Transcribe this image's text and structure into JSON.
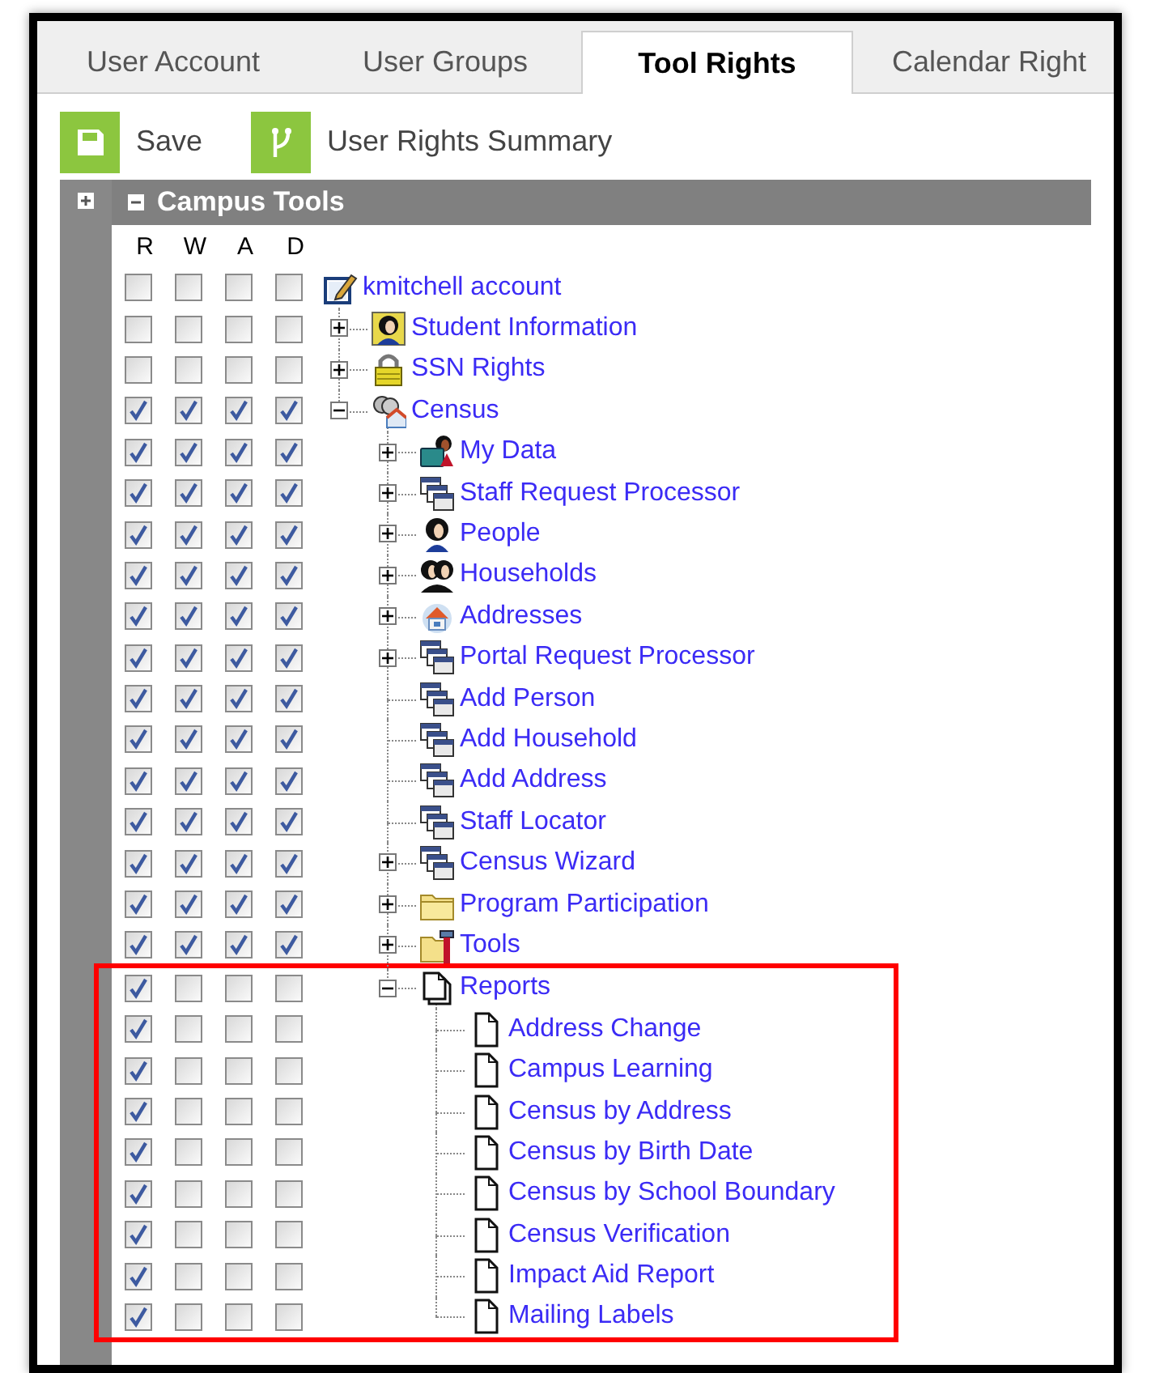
{
  "tabs": [
    {
      "label": "User Account",
      "selected": false
    },
    {
      "label": "User Groups",
      "selected": false
    },
    {
      "label": "Tool Rights",
      "selected": true
    },
    {
      "label": "Calendar Right",
      "selected": false
    }
  ],
  "toolbar": [
    {
      "label": "Save",
      "kind": "save"
    },
    {
      "label": "User Rights Summary",
      "kind": "summary"
    }
  ],
  "panel": {
    "title": "Campus Tools",
    "expanded": true,
    "columns": [
      "R",
      "W",
      "A",
      "D"
    ]
  },
  "tree": [
    {
      "label": "kmitchell account",
      "kind": "edit",
      "rights": [
        false,
        false,
        false,
        false
      ],
      "children": [
        {
          "label": "Student Information",
          "kind": "student",
          "expanded": false,
          "rights": [
            false,
            false,
            false,
            false
          ]
        },
        {
          "label": "SSN Rights",
          "kind": "lock",
          "expanded": false,
          "rights": [
            false,
            false,
            false,
            false
          ]
        },
        {
          "label": "Census",
          "kind": "census",
          "expanded": true,
          "rights": [
            true,
            true,
            true,
            true
          ],
          "children": [
            {
              "label": "My Data",
              "kind": "mydata",
              "expanded": false,
              "rights": [
                true,
                true,
                true,
                true
              ]
            },
            {
              "label": "Staff Request Processor",
              "kind": "windows",
              "expanded": false,
              "rights": [
                true,
                true,
                true,
                true
              ]
            },
            {
              "label": "People",
              "kind": "person",
              "expanded": false,
              "rights": [
                true,
                true,
                true,
                true
              ]
            },
            {
              "label": "Households",
              "kind": "people",
              "expanded": false,
              "rights": [
                true,
                true,
                true,
                true
              ]
            },
            {
              "label": "Addresses",
              "kind": "house",
              "expanded": false,
              "rights": [
                true,
                true,
                true,
                true
              ]
            },
            {
              "label": "Portal Request Processor",
              "kind": "windows",
              "expanded": false,
              "rights": [
                true,
                true,
                true,
                true
              ]
            },
            {
              "label": "Add Person",
              "kind": "windows",
              "rights": [
                true,
                true,
                true,
                true
              ]
            },
            {
              "label": "Add Household",
              "kind": "windows",
              "rights": [
                true,
                true,
                true,
                true
              ]
            },
            {
              "label": "Add Address",
              "kind": "windows",
              "rights": [
                true,
                true,
                true,
                true
              ]
            },
            {
              "label": "Staff Locator",
              "kind": "windows",
              "rights": [
                true,
                true,
                true,
                true
              ]
            },
            {
              "label": "Census Wizard",
              "kind": "windows",
              "expanded": false,
              "rights": [
                true,
                true,
                true,
                true
              ]
            },
            {
              "label": "Program Participation",
              "kind": "folder",
              "expanded": false,
              "rights": [
                true,
                true,
                true,
                true
              ]
            },
            {
              "label": "Tools",
              "kind": "tools",
              "expanded": false,
              "rights": [
                true,
                true,
                true,
                true
              ]
            },
            {
              "label": "Reports",
              "kind": "documents",
              "expanded": true,
              "highlighted": true,
              "rights": [
                true,
                false,
                false,
                false
              ],
              "children": [
                {
                  "label": "Address Change",
                  "kind": "document",
                  "rights": [
                    true,
                    false,
                    false,
                    false
                  ]
                },
                {
                  "label": "Campus Learning",
                  "kind": "document",
                  "rights": [
                    true,
                    false,
                    false,
                    false
                  ]
                },
                {
                  "label": "Census by Address",
                  "kind": "document",
                  "rights": [
                    true,
                    false,
                    false,
                    false
                  ]
                },
                {
                  "label": "Census by Birth Date",
                  "kind": "document",
                  "rights": [
                    true,
                    false,
                    false,
                    false
                  ]
                },
                {
                  "label": "Census by School Boundary",
                  "kind": "document",
                  "rights": [
                    true,
                    false,
                    false,
                    false
                  ]
                },
                {
                  "label": "Census Verification",
                  "kind": "document",
                  "rights": [
                    true,
                    false,
                    false,
                    false
                  ]
                },
                {
                  "label": "Impact Aid Report",
                  "kind": "document",
                  "rights": [
                    true,
                    false,
                    false,
                    false
                  ]
                },
                {
                  "label": "Mailing Labels",
                  "kind": "document",
                  "rights": [
                    true,
                    false,
                    false,
                    false
                  ]
                }
              ]
            }
          ]
        }
      ]
    }
  ]
}
